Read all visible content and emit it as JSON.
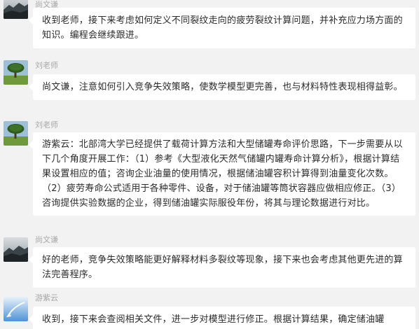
{
  "messages": [
    {
      "sender": "尚文谦",
      "avatar_icon": "mountain-landscape-icon",
      "text": "收到老师，接下来考虑如何定义不同裂纹走向的疲劳裂纹计算问题，并补充应力场方面的知识。编程会继续跟进。"
    },
    {
      "sender": "刘老师",
      "avatar_icon": "tree-landscape-icon",
      "text": "尚文谦，注意如何引入竞争失效策略，使数学模型更完善，也与材料特性表现相得益彰。"
    },
    {
      "sender": "刘老师",
      "avatar_icon": "tree-landscape-icon",
      "text": "游紫云：北部湾大学已经提供了载荷计算方法和大型储罐寿命评价思路，下一步需要从以下几个角度开展工作：（1）参考《大型液化天然气储罐内罐寿命计算分析》，根据计算结果设置相应的值；咨询企业油量的使用情况，根据储油罐容积计算得到油量变化次数。（2）疲劳寿命公式适用于各种零件、设备，对于储油罐等筒状容器应做相应修正。（3）咨询提供实验数据的企业，得到储油罐实际服役年份，将其与理论数据进行对比。"
    },
    {
      "sender": "尚文谦",
      "avatar_icon": "mountain-landscape-icon",
      "text": "好的老师，竞争失效策略能更好解释材料多裂纹等现象，接下来也会考虑其他更先进的算法完善程序。"
    },
    {
      "sender": "游紫云",
      "avatar_icon": "blue-sky-icon",
      "text": "收到，接下来会查阅相关文件，进一步对模型进行修正。根据计算结果，确定储油罐"
    }
  ]
}
